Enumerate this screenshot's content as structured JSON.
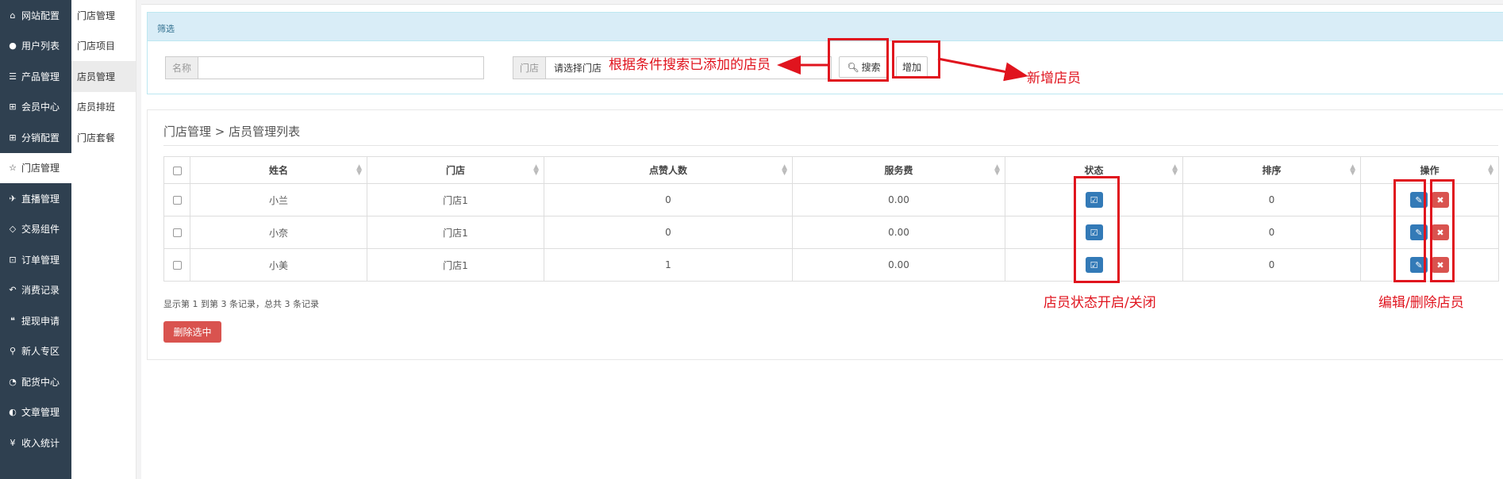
{
  "sidebar": {
    "items": [
      {
        "icon": "home-icon",
        "glyph": "⌂",
        "label": "网站配置"
      },
      {
        "icon": "user-icon",
        "glyph": "●",
        "label": "用户列表"
      },
      {
        "icon": "server-icon",
        "glyph": "☰",
        "label": "产品管理"
      },
      {
        "icon": "cart-icon",
        "glyph": "⊞",
        "label": "会员中心"
      },
      {
        "icon": "cart-icon",
        "glyph": "⊞",
        "label": "分销配置"
      },
      {
        "icon": "star-icon",
        "glyph": "☆",
        "label": "门店管理"
      },
      {
        "icon": "plane-icon",
        "glyph": "✈",
        "label": "直播管理"
      },
      {
        "icon": "eraser-icon",
        "glyph": "◇",
        "label": "交易组件"
      },
      {
        "icon": "cart-check-icon",
        "glyph": "⊡",
        "label": "订单管理"
      },
      {
        "icon": "reply-icon",
        "glyph": "↶",
        "label": "消费记录"
      },
      {
        "icon": "comments-icon",
        "glyph": "❝",
        "label": "提现申请"
      },
      {
        "icon": "map-pin-icon",
        "glyph": "⚲",
        "label": "新人专区"
      },
      {
        "icon": "pie-chart-icon",
        "glyph": "◔",
        "label": "配货中心"
      },
      {
        "icon": "adjust-icon",
        "glyph": "◐",
        "label": "文章管理"
      },
      {
        "icon": "yen-icon",
        "glyph": "¥",
        "label": "收入统计"
      }
    ]
  },
  "submenu": {
    "items": [
      "门店管理",
      "门店项目",
      "店员管理",
      "店员排班",
      "门店套餐"
    ]
  },
  "filter": {
    "heading": "筛选",
    "name_label": "名称",
    "name_value": "",
    "store_label": "门店",
    "store_value": "请选择门店",
    "search_label": "搜索",
    "add_label": "增加"
  },
  "list": {
    "breadcrumb": "门店管理 > 店员管理列表",
    "columns": [
      "姓名",
      "门店",
      "点赞人数",
      "服务费",
      "状态",
      "排序",
      "操作"
    ],
    "rows": [
      {
        "name": "小兰",
        "store": "门店1",
        "likes": "0",
        "fee": "0.00",
        "sort": "0"
      },
      {
        "name": "小奈",
        "store": "门店1",
        "likes": "0",
        "fee": "0.00",
        "sort": "0"
      },
      {
        "name": "小美",
        "store": "门店1",
        "likes": "1",
        "fee": "0.00",
        "sort": "0"
      }
    ],
    "records": "显示第 1 到第 3 条记录，总共 3 条记录",
    "delete_selected": "删除选中"
  },
  "annotations": {
    "search_note": "根据条件搜索已添加的店员",
    "add_note": "新增店员",
    "status_note": "店员状态开启/关闭",
    "edit_note": "编辑/删除店员",
    "color": "#e0141e"
  }
}
